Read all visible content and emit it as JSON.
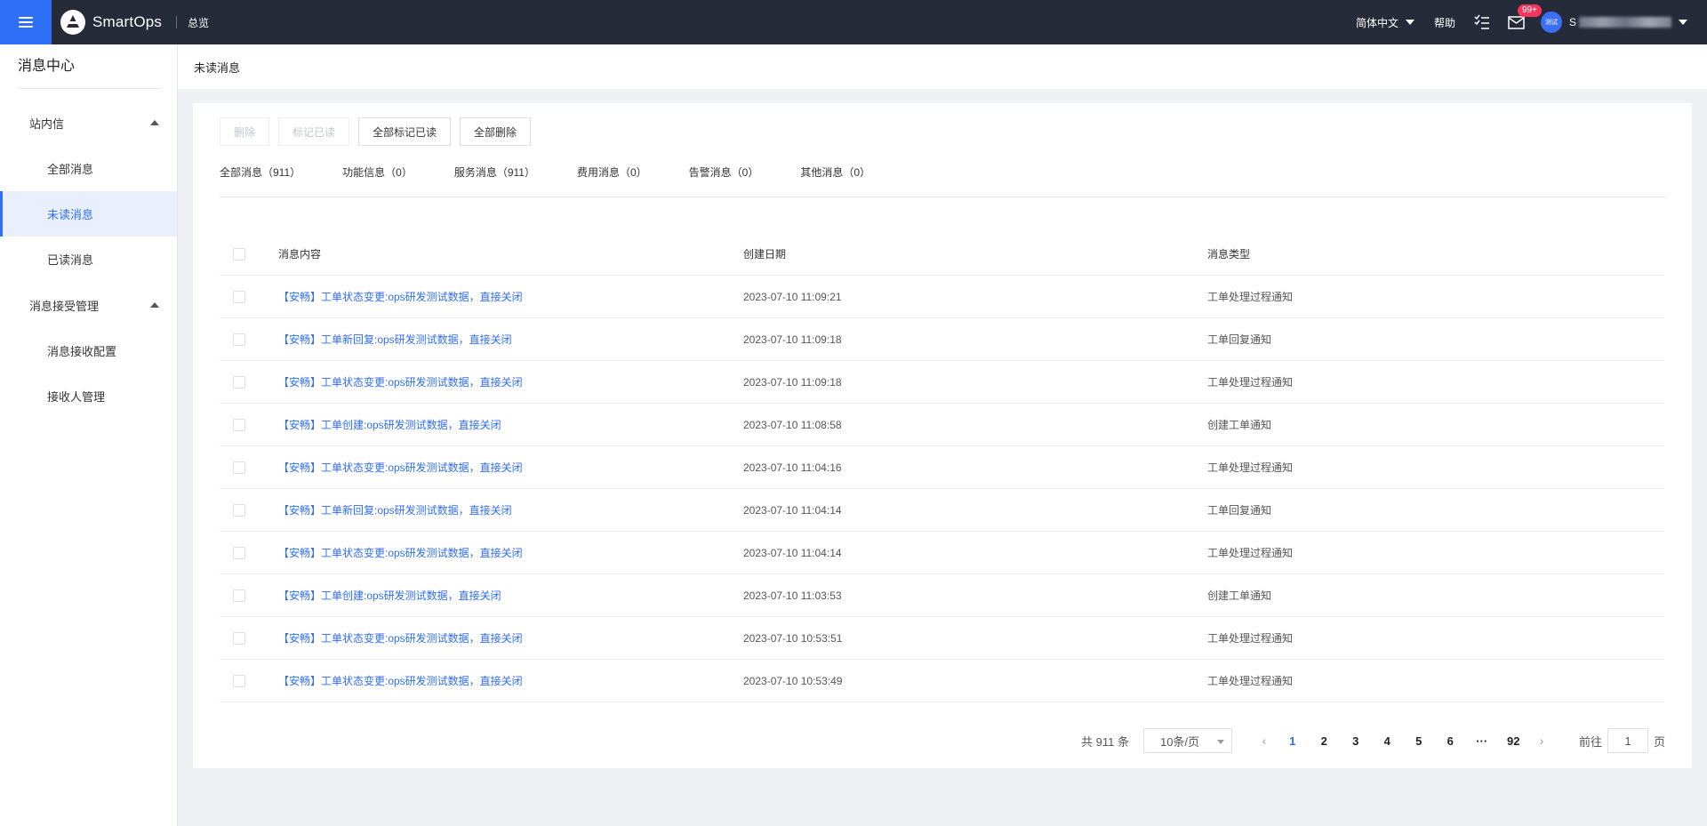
{
  "topbar": {
    "logo_text": "SmartOps",
    "overview": "总览",
    "language": "简体中文",
    "help": "帮助",
    "mail_badge": "99+",
    "avatar_text": "测试",
    "username_initial": "S"
  },
  "sidebar": {
    "title": "消息中心",
    "groups": [
      {
        "label": "站内信",
        "items": [
          "全部消息",
          "未读消息",
          "已读消息"
        ]
      },
      {
        "label": "消息接受管理",
        "items": [
          "消息接收配置",
          "接收人管理"
        ]
      }
    ],
    "active_item": "未读消息"
  },
  "page": {
    "title": "未读消息"
  },
  "toolbar": {
    "delete": "删除",
    "mark_read": "标记已读",
    "mark_all_read": "全部标记已读",
    "delete_all": "全部删除"
  },
  "tabs": [
    "全部消息（911）",
    "功能信息（0）",
    "服务消息（911）",
    "费用消息（0）",
    "告警消息（0）",
    "其他消息（0）"
  ],
  "table": {
    "headers": {
      "content": "消息内容",
      "date": "创建日期",
      "type": "消息类型"
    },
    "rows": [
      {
        "content": "【安畅】工单状态变更:ops研发测试数据，直接关闭",
        "date": "2023-07-10 11:09:21",
        "type": "工单处理过程通知"
      },
      {
        "content": "【安畅】工单新回复:ops研发测试数据，直接关闭",
        "date": "2023-07-10 11:09:18",
        "type": "工单回复通知"
      },
      {
        "content": "【安畅】工单状态变更:ops研发测试数据，直接关闭",
        "date": "2023-07-10 11:09:18",
        "type": "工单处理过程通知"
      },
      {
        "content": "【安畅】工单创建:ops研发测试数据，直接关闭",
        "date": "2023-07-10 11:08:58",
        "type": "创建工单通知"
      },
      {
        "content": "【安畅】工单状态变更:ops研发测试数据，直接关闭",
        "date": "2023-07-10 11:04:16",
        "type": "工单处理过程通知"
      },
      {
        "content": "【安畅】工单新回复:ops研发测试数据，直接关闭",
        "date": "2023-07-10 11:04:14",
        "type": "工单回复通知"
      },
      {
        "content": "【安畅】工单状态变更:ops研发测试数据，直接关闭",
        "date": "2023-07-10 11:04:14",
        "type": "工单处理过程通知"
      },
      {
        "content": "【安畅】工单创建:ops研发测试数据，直接关闭",
        "date": "2023-07-10 11:03:53",
        "type": "创建工单通知"
      },
      {
        "content": "【安畅】工单状态变更:ops研发测试数据，直接关闭",
        "date": "2023-07-10 10:53:51",
        "type": "工单处理过程通知"
      },
      {
        "content": "【安畅】工单状态变更:ops研发测试数据，直接关闭",
        "date": "2023-07-10 10:53:49",
        "type": "工单处理过程通知"
      }
    ]
  },
  "pagination": {
    "total": "共 911 条",
    "page_size": "10条/页",
    "pages": [
      "1",
      "2",
      "3",
      "4",
      "5",
      "6",
      "···",
      "92"
    ],
    "current": "1",
    "goto_label": "前往",
    "goto_value": "1",
    "page_unit": "页"
  },
  "colors": {
    "accent": "#2f6ef6",
    "topbar": "#262b3a",
    "badge": "#f5365c"
  }
}
